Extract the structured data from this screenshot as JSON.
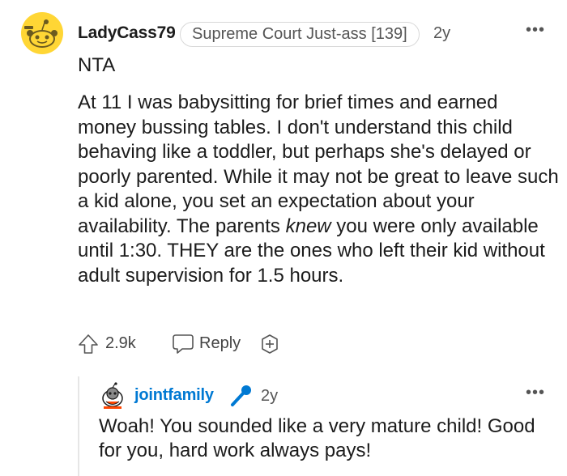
{
  "comment": {
    "username": "LadyCass79",
    "flair": "Supreme Court Just-ass [139]",
    "age": "2y",
    "more": "•••",
    "verdict": "NTA",
    "body_part1": "At 11 I was babysitting for brief times and earned money bussing tables. I don't understand this child behaving like a toddler, but perhaps she's delayed or poorly parented. While it may not be great to leave such a kid alone, you set an expectation about your availability. The parents ",
    "body_emphasis": "knew",
    "body_part2": " you were only available until 1:30. THEY are the ones who left their kid without adult supervision for 1.5 hours.",
    "score": "2.9k",
    "reply_label": "Reply",
    "avatar_color": "#ffd635"
  },
  "reply": {
    "username": "jointfamily",
    "age": "2y",
    "more": "•••",
    "text": "Woah! You sounded like a very mature child! Good for you, hard work always pays!",
    "username_color": "#0079d3"
  },
  "icons": [
    "snoo-avatar-icon",
    "more-options-icon",
    "upvote-icon",
    "reply-icon",
    "award-icon",
    "snoo-avatar-icon",
    "microphone-icon"
  ]
}
